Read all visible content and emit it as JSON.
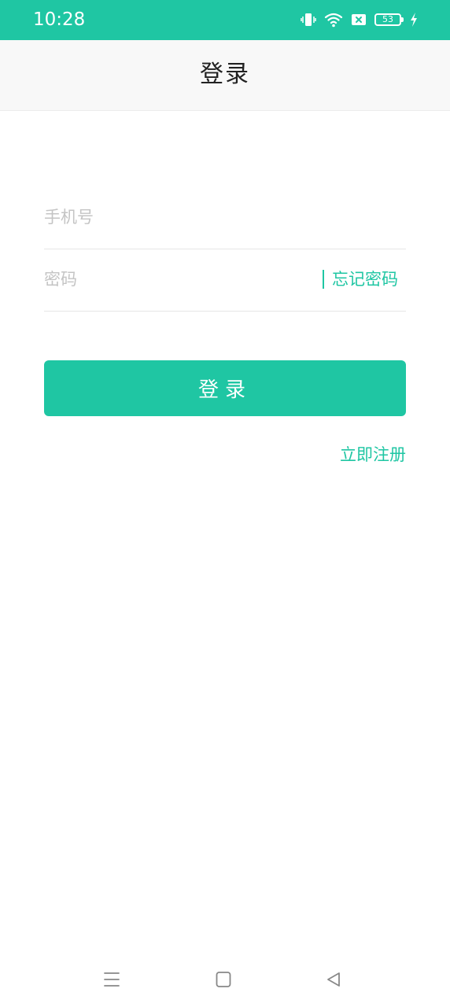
{
  "status_bar": {
    "time": "10:28",
    "battery": "53",
    "icons": [
      "vibrate-icon",
      "wifi-icon",
      "sim-error-icon",
      "battery-icon",
      "charging-icon"
    ]
  },
  "header": {
    "title": "登录"
  },
  "form": {
    "phone_placeholder": "手机号",
    "password_placeholder": "密码",
    "forgot_label": "忘记密码",
    "login_label": "登录",
    "register_label": "立即注册"
  },
  "nav_bar": {
    "icons": [
      "menu-icon",
      "home-icon",
      "back-icon"
    ]
  },
  "colors": {
    "accent": "#1fc6a3",
    "title_bar_bg": "#f8f8f8",
    "placeholder": "#c4c4c4"
  }
}
